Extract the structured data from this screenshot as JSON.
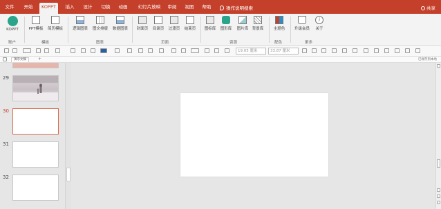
{
  "tabs": [
    "文件",
    "开始",
    "KOPPT",
    "插入",
    "设计",
    "切换",
    "动画",
    "幻灯片放映",
    "审阅",
    "视图",
    "帮助"
  ],
  "active_tab": "KOPPT",
  "search_label": "操作说明搜索",
  "share_label": "共享",
  "ribbon": {
    "koppt_label": "KOPPT",
    "groups": [
      "账户",
      "模板",
      "图表",
      "页面",
      "资源",
      "配色",
      "更多"
    ],
    "buttons": {
      "ppt_template": "PPT模板",
      "resume_template": "简历模板",
      "logic_chart": "逻辑图表",
      "text_layout": "图文排版",
      "data_chart": "数据图表",
      "cover_page": "封面页",
      "toc_page": "目录页",
      "transition_page": "过渡页",
      "end_page": "结束页",
      "icon_lib": "图标库",
      "shape_lib": "图形库",
      "image_lib": "图片库",
      "bg_lib": "背景库",
      "theme_color": "主题色",
      "upgrade_member": "升级会员",
      "about": "关于"
    }
  },
  "format": {
    "width_value": "19.05 厘米",
    "height_value": "33.87 厘米"
  },
  "doc_tab_label": "演示文稿",
  "doc_right_label": "已保存到本地",
  "slides": [
    {
      "number": "29"
    },
    {
      "number": "30"
    },
    {
      "number": "31"
    },
    {
      "number": "32"
    }
  ],
  "active_slide": "30",
  "colors": {
    "accent": "#c4402a",
    "ribbon_bg": "#f3f3f3",
    "workspace_bg": "#e6e6e6",
    "active_slide_border": "#d86a4b"
  }
}
